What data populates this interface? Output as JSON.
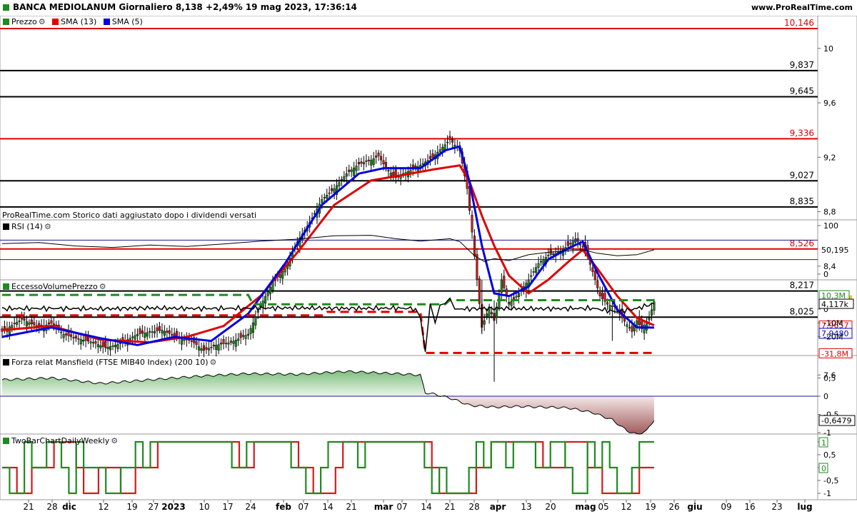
{
  "header": {
    "title": "BANCA MEDIOLANUM Giornaliero 8,138 +2,49% 19 mag 2023, 17:36:14",
    "site": "www.ProRealTime.com"
  },
  "price_panel": {
    "legend": [
      {
        "label": "Prezzo",
        "color": "#1f8a1f"
      },
      {
        "label": "SMA (13)",
        "color": "#e00000"
      },
      {
        "label": "SMA (5)",
        "color": "#0000e0"
      }
    ],
    "note": "ProRealTime.com Storico dati aggiustato dopo i dividendi versati"
  },
  "rsi_panel": {
    "legend": "RSI (14)"
  },
  "volume_panel": {
    "legend": "EccessoVolumePrezzo"
  },
  "mansfield_panel": {
    "legend": "Forza relat Mansfield (FTSE MIB40 Index) (200 10)"
  },
  "twobar_panel": {
    "legend": "TwoBarChartDailyWeekly"
  },
  "colors": {
    "bull": "#1f8a1f",
    "bear": "#d21c1c",
    "sma13": "#e00000",
    "sma5": "#0000e0",
    "last_price_box": "#f0c419"
  },
  "chart_data": [
    {
      "type": "candlestick",
      "title": "BANCA MEDIOLANUM Giornaliero",
      "ylim": [
        7.45,
        10.2
      ],
      "y_ticks": [
        "10",
        "9,6",
        "9,2",
        "8,8",
        "8,4",
        "7,6"
      ],
      "x_ticks": [
        "21",
        "28",
        "dic",
        "12",
        "19",
        "27",
        "2023",
        "10",
        "17",
        "24",
        "feb",
        "07",
        "14",
        "21",
        "mar",
        "07",
        "14",
        "21",
        "28",
        "apr",
        "13",
        "20",
        "mag",
        "05",
        "12",
        "19",
        "26",
        "giu",
        "09",
        "16",
        "23",
        "lug"
      ],
      "last_price": 8.138,
      "last_price_label": "8,138",
      "levels": [
        {
          "value": 10.146,
          "label": "10,146",
          "color": "#e00000"
        },
        {
          "value": 9.837,
          "label": "9,837",
          "color": "#000000"
        },
        {
          "value": 9.645,
          "label": "9,645",
          "color": "#000000"
        },
        {
          "value": 9.336,
          "label": "9,336",
          "color": "#e00000"
        },
        {
          "value": 9.027,
          "label": "9,027",
          "color": "#000000"
        },
        {
          "value": 8.835,
          "label": "8,835",
          "color": "#000000"
        },
        {
          "value": 8.526,
          "label": "8,526",
          "color": "#e00000"
        },
        {
          "value": 8.217,
          "label": "8,217",
          "color": "#000000"
        },
        {
          "value": 8.025,
          "label": "8,025",
          "color": "#000000"
        }
      ],
      "sma13_last": "7,9657",
      "sma5_last": "7,9480",
      "close_path": [
        [
          0,
          7.92
        ],
        [
          8,
          8.01
        ],
        [
          15,
          7.95
        ],
        [
          20,
          7.98
        ],
        [
          25,
          7.9
        ],
        [
          30,
          7.87
        ],
        [
          37,
          7.84
        ],
        [
          42,
          7.8
        ],
        [
          48,
          7.83
        ],
        [
          55,
          7.9
        ],
        [
          65,
          7.93
        ],
        [
          72,
          7.87
        ],
        [
          77,
          7.85
        ],
        [
          82,
          7.78
        ],
        [
          87,
          7.82
        ],
        [
          93,
          7.84
        ],
        [
          100,
          7.9
        ],
        [
          105,
          8.11
        ],
        [
          110,
          8.28
        ],
        [
          115,
          8.38
        ],
        [
          120,
          8.58
        ],
        [
          125,
          8.72
        ],
        [
          130,
          8.89
        ],
        [
          135,
          8.97
        ],
        [
          140,
          9.08
        ],
        [
          145,
          9.15
        ],
        [
          150,
          9.18
        ],
        [
          153,
          9.21
        ],
        [
          156,
          9.12
        ],
        [
          160,
          9.05
        ],
        [
          163,
          9.08
        ],
        [
          168,
          9.12
        ],
        [
          175,
          9.2
        ],
        [
          182,
          9.33
        ],
        [
          186,
          9.25
        ],
        [
          189,
          8.97
        ],
        [
          191,
          8.65
        ],
        [
          193,
          8.3
        ],
        [
          195,
          7.95
        ],
        [
          198,
          8.1
        ],
        [
          200,
          8.0
        ],
        [
          203,
          8.3
        ],
        [
          206,
          8.12
        ],
        [
          210,
          8.2
        ],
        [
          214,
          8.3
        ],
        [
          218,
          8.42
        ],
        [
          222,
          8.48
        ],
        [
          226,
          8.5
        ],
        [
          230,
          8.55
        ],
        [
          233,
          8.6
        ],
        [
          237,
          8.52
        ],
        [
          240,
          8.36
        ],
        [
          243,
          8.18
        ],
        [
          246,
          8.12
        ],
        [
          249,
          8.1
        ],
        [
          252,
          8.02
        ],
        [
          256,
          7.92
        ],
        [
          258,
          8.0
        ],
        [
          260,
          7.94
        ],
        [
          263,
          8.02
        ],
        [
          265,
          8.138
        ]
      ],
      "sma13_path": [
        [
          0,
          7.93
        ],
        [
          20,
          7.96
        ],
        [
          40,
          7.86
        ],
        [
          60,
          7.84
        ],
        [
          75,
          7.88
        ],
        [
          90,
          7.96
        ],
        [
          105,
          8.18
        ],
        [
          120,
          8.5
        ],
        [
          135,
          8.85
        ],
        [
          150,
          9.03
        ],
        [
          160,
          9.06
        ],
        [
          175,
          9.11
        ],
        [
          186,
          9.14
        ],
        [
          190,
          9.02
        ],
        [
          195,
          8.77
        ],
        [
          200,
          8.55
        ],
        [
          206,
          8.33
        ],
        [
          214,
          8.2
        ],
        [
          222,
          8.3
        ],
        [
          230,
          8.43
        ],
        [
          236,
          8.52
        ],
        [
          242,
          8.38
        ],
        [
          250,
          8.18
        ],
        [
          258,
          8.02
        ],
        [
          265,
          7.9657
        ]
      ],
      "sma5_path": [
        [
          0,
          7.88
        ],
        [
          20,
          7.95
        ],
        [
          40,
          7.87
        ],
        [
          55,
          7.82
        ],
        [
          70,
          7.88
        ],
        [
          85,
          7.85
        ],
        [
          100,
          8.05
        ],
        [
          115,
          8.42
        ],
        [
          130,
          8.85
        ],
        [
          145,
          9.08
        ],
        [
          155,
          9.12
        ],
        [
          170,
          9.12
        ],
        [
          180,
          9.25
        ],
        [
          186,
          9.28
        ],
        [
          190,
          9.02
        ],
        [
          195,
          8.55
        ],
        [
          200,
          8.2
        ],
        [
          206,
          8.18
        ],
        [
          214,
          8.25
        ],
        [
          222,
          8.45
        ],
        [
          230,
          8.53
        ],
        [
          236,
          8.58
        ],
        [
          242,
          8.35
        ],
        [
          250,
          8.08
        ],
        [
          258,
          7.95
        ],
        [
          265,
          7.948
        ]
      ]
    },
    {
      "type": "line",
      "title": "RSI (14)",
      "ylim": [
        0,
        100
      ],
      "y_ticks": [
        "100",
        "0"
      ],
      "bands": [
        70,
        30
      ],
      "last_label": "50,195",
      "path": [
        [
          0,
          63
        ],
        [
          15,
          65
        ],
        [
          30,
          58
        ],
        [
          45,
          55
        ],
        [
          60,
          60
        ],
        [
          75,
          57
        ],
        [
          90,
          62
        ],
        [
          105,
          68
        ],
        [
          120,
          72
        ],
        [
          135,
          79
        ],
        [
          150,
          80
        ],
        [
          160,
          73
        ],
        [
          170,
          68
        ],
        [
          182,
          73
        ],
        [
          186,
          67
        ],
        [
          192,
          38
        ],
        [
          196,
          26
        ],
        [
          200,
          32
        ],
        [
          206,
          28
        ],
        [
          214,
          40
        ],
        [
          222,
          45
        ],
        [
          230,
          48
        ],
        [
          236,
          50
        ],
        [
          242,
          43
        ],
        [
          250,
          38
        ],
        [
          258,
          40
        ],
        [
          265,
          50.195
        ]
      ]
    },
    {
      "type": "line",
      "title": "EccessoVolumePrezzo",
      "ylim": [
        -34,
        13
      ],
      "y_ticks": [
        "0",
        "-10M",
        "-20M"
      ],
      "last_labels": [
        "10,3M",
        "4,117k",
        "-31,8M"
      ],
      "upper_band": [
        [
          0,
          10.3
        ],
        [
          100,
          10.3
        ],
        [
          102,
          3.5
        ],
        [
          180,
          3.5
        ],
        [
          182,
          6.5
        ],
        [
          265,
          6.5
        ]
      ],
      "lower_band": [
        [
          0,
          -4.5
        ],
        [
          130,
          -4.5
        ],
        [
          132,
          -2.0
        ],
        [
          170,
          -2.0
        ],
        [
          172,
          -31.8
        ],
        [
          265,
          -31.8
        ]
      ],
      "path": [
        [
          0,
          0.3
        ],
        [
          20,
          0.5
        ],
        [
          40,
          0.2
        ],
        [
          60,
          0.8
        ],
        [
          80,
          0.4
        ],
        [
          100,
          0.6
        ],
        [
          120,
          0.9
        ],
        [
          140,
          0.5
        ],
        [
          160,
          0.7
        ],
        [
          168,
          0.4
        ],
        [
          170,
          -6
        ],
        [
          172,
          -31
        ],
        [
          174,
          4
        ],
        [
          176,
          -10
        ],
        [
          178,
          3
        ],
        [
          180,
          4
        ],
        [
          182,
          8
        ],
        [
          184,
          0
        ],
        [
          200,
          0.5
        ],
        [
          220,
          0.3
        ],
        [
          240,
          0.6
        ],
        [
          250,
          -2
        ],
        [
          258,
          0.5
        ],
        [
          265,
          4.117
        ]
      ]
    },
    {
      "type": "area",
      "title": "Forza relat Mansfield (FTSE MIB40 Index) (200 10)",
      "ylim": [
        -1.15,
        0.75
      ],
      "y_ticks": [
        "0,5",
        "0",
        "-0,5",
        "-1"
      ],
      "last_label": "-0,6479",
      "path": [
        [
          0,
          0.45
        ],
        [
          20,
          0.5
        ],
        [
          40,
          0.35
        ],
        [
          60,
          0.45
        ],
        [
          80,
          0.55
        ],
        [
          100,
          0.62
        ],
        [
          120,
          0.6
        ],
        [
          140,
          0.68
        ],
        [
          160,
          0.62
        ],
        [
          170,
          0.58
        ],
        [
          172,
          0.1
        ],
        [
          176,
          0.05
        ],
        [
          182,
          -0.05
        ],
        [
          190,
          -0.25
        ],
        [
          200,
          -0.3
        ],
        [
          210,
          -0.28
        ],
        [
          220,
          -0.3
        ],
        [
          230,
          -0.32
        ],
        [
          240,
          -0.45
        ],
        [
          248,
          -0.65
        ],
        [
          254,
          -0.95
        ],
        [
          258,
          -1.05
        ],
        [
          262,
          -0.95
        ],
        [
          265,
          -0.6479
        ]
      ]
    },
    {
      "type": "step",
      "title": "TwoBarChartDailyWeekly",
      "ylim": [
        -1.2,
        1.2
      ],
      "y_ticks": [
        "1",
        "0,5",
        "0",
        "-0,5",
        "-1"
      ],
      "last_labels": [
        "1",
        "0"
      ],
      "series": [
        {
          "name": "Daily",
          "color": "#1f8a1f",
          "values": [
            0,
            -1,
            -1,
            1,
            0,
            0,
            1,
            1,
            0,
            -1,
            1,
            0,
            0,
            0,
            -1,
            -1,
            0,
            0,
            1,
            0,
            1,
            1,
            1,
            1,
            1,
            1,
            1,
            1,
            1,
            1,
            1,
            0,
            0,
            1,
            1,
            1,
            1,
            1,
            1,
            0,
            0,
            -1,
            -1,
            0,
            1,
            1,
            1,
            1,
            0,
            1,
            1,
            1,
            1,
            1,
            1,
            1,
            1,
            0,
            -1,
            0,
            -1,
            -1,
            -1,
            0,
            1,
            0,
            1,
            1,
            0,
            1,
            1,
            1,
            0,
            0,
            1,
            1,
            0,
            -1,
            -1,
            1,
            0,
            1,
            0,
            -1,
            -1,
            0,
            1,
            1,
            1
          ]
        },
        {
          "name": "Weekly",
          "color": "#d21c1c",
          "values": [
            0,
            0,
            -1,
            -1,
            0,
            0,
            0,
            1,
            1,
            1,
            0,
            -1,
            -1,
            0,
            0,
            0,
            -1,
            -1,
            0,
            0,
            0,
            1,
            1,
            1,
            1,
            1,
            1,
            1,
            1,
            1,
            1,
            1,
            0,
            0,
            1,
            1,
            1,
            1,
            1,
            1,
            0,
            0,
            -1,
            -1,
            -1,
            0,
            1,
            1,
            1,
            1,
            1,
            1,
            1,
            1,
            1,
            1,
            1,
            1,
            0,
            -1,
            -1,
            -1,
            -1,
            -1,
            0,
            0,
            1,
            1,
            1,
            1,
            1,
            1,
            1,
            0,
            0,
            0,
            1,
            1,
            1,
            0,
            0,
            -1,
            -1,
            -1,
            -1,
            -1,
            0,
            0,
            0
          ]
        }
      ]
    }
  ]
}
